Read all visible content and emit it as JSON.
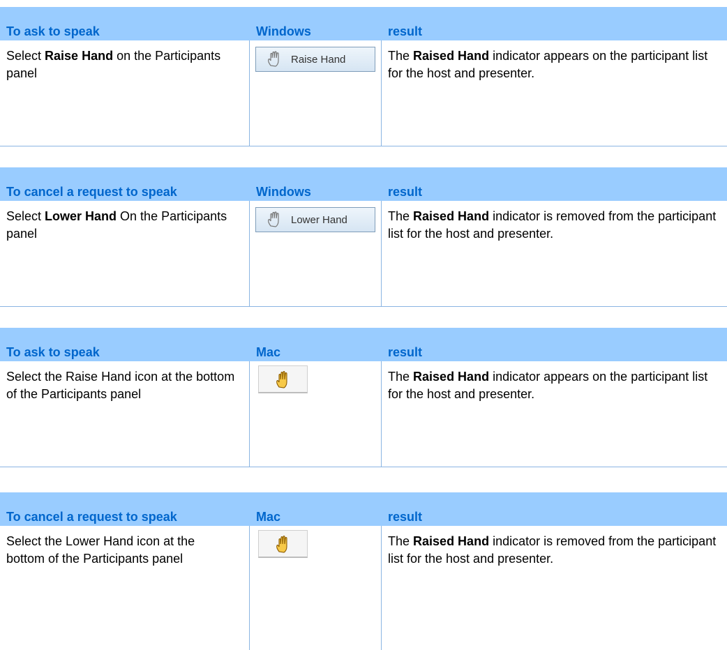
{
  "sections": [
    {
      "headers": [
        "To ask to speak",
        "Windows",
        "result"
      ],
      "action_prefix": "Select ",
      "action_bold": "Raise Hand",
      "action_suffix": " on the Participants panel",
      "button_label": "Raise Hand",
      "result_prefix": "The ",
      "result_bold": "Raised Hand",
      "result_suffix": " indicator appears on the participant list for the host and presenter."
    },
    {
      "headers": [
        "To cancel a request to speak",
        "Windows",
        "result"
      ],
      "action_prefix": "Select ",
      "action_bold": "Lower Hand",
      "action_suffix": " On the Participants panel",
      "button_label": "Lower Hand",
      "result_prefix": "The ",
      "result_bold": "Raised Hand",
      "result_suffix": " indicator is removed from the participant list for the host and presenter."
    },
    {
      "headers": [
        "To ask to speak",
        "Mac",
        "result"
      ],
      "action_text": "Select the Raise Hand icon at the bottom of the Participants panel",
      "result_prefix": "The ",
      "result_bold": "Raised Hand",
      "result_suffix": " indicator appears on the participant list for the host and presenter."
    },
    {
      "headers": [
        "To cancel a request to speak",
        "Mac",
        "result"
      ],
      "action_text": "Select the Lower Hand icon at the bottom of the Participants panel",
      "result_prefix": "The ",
      "result_bold": "Raised Hand",
      "result_suffix": " indicator is removed from the participant list for the host and presenter."
    }
  ],
  "colors": {
    "header_bg": "#99ccff",
    "header_text": "#0066cc",
    "rule": "#8ab4e2"
  },
  "icons": {
    "windows_button_icon": "hand-outline-icon",
    "mac_button_icon": "hand-yellow-icon"
  }
}
